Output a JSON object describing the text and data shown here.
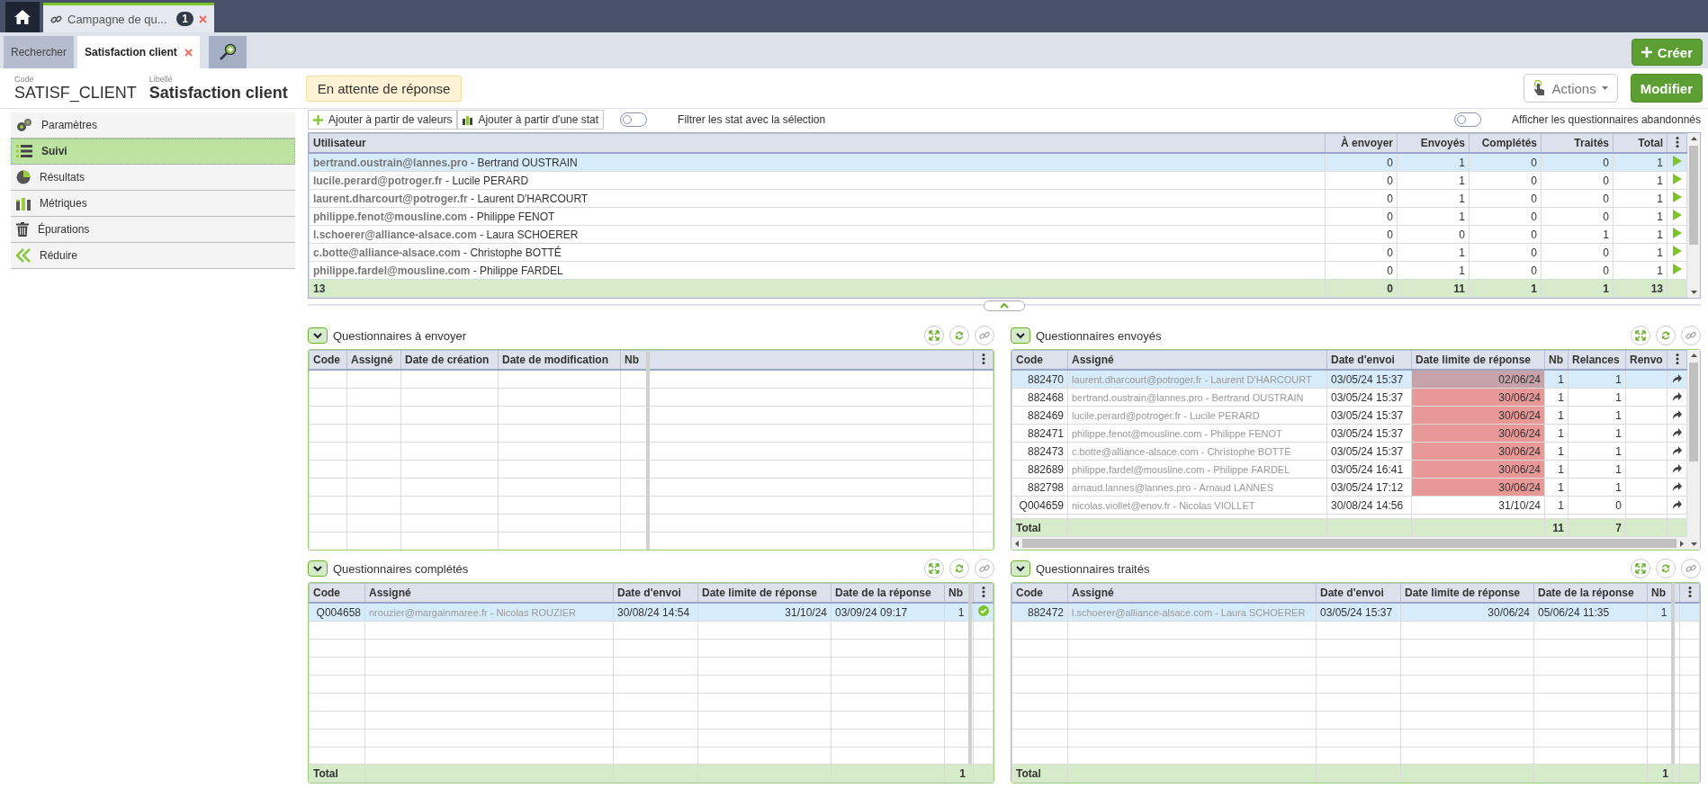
{
  "top_tabs": [
    {
      "label": "Campagne de qu...",
      "badge": "1",
      "selected": true
    }
  ],
  "page_tabs": [
    {
      "label": "Rechercher",
      "selected": false,
      "closable": false
    },
    {
      "label": "Satisfaction client",
      "selected": true,
      "closable": true
    }
  ],
  "create_button": "Créer",
  "header": {
    "code_label": "Code",
    "code": "SATISF_CLIENT",
    "name_label": "Libellé",
    "name": "Satisfaction client",
    "status": "En attente de réponse",
    "actions": "Actions",
    "edit": "Modifier"
  },
  "sidebar": [
    {
      "label": "Paramètres",
      "selected": false
    },
    {
      "label": "Suivi",
      "selected": true
    },
    {
      "label": "Résultats",
      "selected": false
    },
    {
      "label": "Métriques",
      "selected": false
    },
    {
      "label": "Épurations",
      "selected": false
    },
    {
      "label": "Réduire",
      "selected": false
    }
  ],
  "toolbar": {
    "add_values": "Ajouter à partir de valeurs",
    "add_stat": "Ajouter à partir d'une stat",
    "filter": {
      "label": "Filtrer les stat avec la sélection",
      "on": false
    },
    "abandoned": {
      "label": "Afficher les questionnaires abandonnés",
      "on": false
    }
  },
  "users_table": {
    "columns": [
      "Utilisateur",
      "À envoyer",
      "Envoyés",
      "Complétés",
      "Traités",
      "Total"
    ],
    "rows": [
      {
        "user": "**bertrand.oustrain@lannes.pro** - Bertrand OUSTRAIN",
        "values": [
          "0",
          "1",
          "0",
          "0",
          "1"
        ],
        "selected": true
      },
      {
        "user": "**lucile.perard@potroger.fr** - Lucile PERARD",
        "values": [
          "0",
          "1",
          "0",
          "0",
          "1"
        ],
        "selected": false
      },
      {
        "user": "**laurent.dharcourt@potroger.fr** - Laurent D'HARCOURT",
        "values": [
          "0",
          "1",
          "0",
          "0",
          "1"
        ],
        "selected": false
      },
      {
        "user": "**philippe.fenot@mousline.com** - Philippe FENOT",
        "values": [
          "0",
          "1",
          "0",
          "0",
          "1"
        ],
        "selected": false
      },
      {
        "user": "**l.schoerer@alliance-alsace.com** - Laura SCHOERER",
        "values": [
          "0",
          "0",
          "0",
          "1",
          "1"
        ],
        "selected": false
      },
      {
        "user": "**c.botte@alliance-alsace.com** - Christophe BOTTÉ",
        "values": [
          "0",
          "1",
          "0",
          "0",
          "1"
        ],
        "selected": false
      },
      {
        "user": "**philippe.fardel@mousline.com** - Philippe FARDEL",
        "values": [
          "0",
          "1",
          "0",
          "0",
          "1"
        ],
        "selected": false
      }
    ],
    "total": [
      "13",
      "0",
      "11",
      "1",
      "1",
      "13"
    ]
  },
  "panels": [
    {
      "title": "Questionnaires à envoyer",
      "columns": [
        "Code",
        "Assigné",
        "Date de création",
        "Date de modification",
        "Nb"
      ]
    },
    {
      "title": "Questionnaires envoyés",
      "columns": [
        "Code",
        "Assigné",
        "Date d'envoi",
        "Date limite de réponse",
        "Nb",
        "Relances",
        "Renvo"
      ],
      "rows": [
        {
          "cells": [
            "882470",
            "laurent.dharcourt@potroger.fr - Laurent D'HARCOURT",
            "03/05/24 15:37",
            "02/06/24",
            "1",
            "1"
          ],
          "selected": true,
          "overdue": true
        },
        {
          "cells": [
            "882468",
            "bertrand.oustrain@lannes.pro - Bertrand OUSTRAIN",
            "03/05/24 15:37",
            "30/06/24",
            "1",
            "1"
          ],
          "selected": false,
          "overdue": true
        },
        {
          "cells": [
            "882469",
            "lucile.perard@potroger.fr - Lucile PERARD",
            "03/05/24 15:37",
            "30/06/24",
            "1",
            "1"
          ],
          "selected": false,
          "overdue": true
        },
        {
          "cells": [
            "882471",
            "philippe.fenot@mousline.com - Philippe FENOT",
            "03/05/24 15:37",
            "30/06/24",
            "1",
            "1"
          ],
          "selected": false,
          "overdue": true
        },
        {
          "cells": [
            "882473",
            "c.botte@alliance-alsace.com - Christophe BOTTÉ",
            "03/05/24 15:37",
            "30/06/24",
            "1",
            "1"
          ],
          "selected": false,
          "overdue": true
        },
        {
          "cells": [
            "882689",
            "philippe.fardel@mousline.com - Philippe FARDEL",
            "03/05/24 16:41",
            "30/06/24",
            "1",
            "1"
          ],
          "selected": false,
          "overdue": true
        },
        {
          "cells": [
            "882798",
            "arnaud.lannes@lannes.pro - Arnaud LANNES",
            "03/05/24 17:12",
            "30/06/24",
            "1",
            "1"
          ],
          "selected": false,
          "overdue": true
        },
        {
          "cells": [
            "Q004659",
            "nicolas.viollet@enov.fr - Nicolas VIOLLET",
            "30/08/24 14:56",
            "31/10/24",
            "1",
            "0"
          ],
          "selected": false,
          "overdue": false
        }
      ],
      "total": {
        "label": "Total",
        "nb": "11",
        "relances": "7"
      }
    },
    {
      "title": "Questionnaires complétés",
      "columns": [
        "Code",
        "Assigné",
        "Date d'envoi",
        "Date limite de réponse",
        "Date de la réponse",
        "Nb"
      ],
      "rows": [
        {
          "cells": [
            "Q004658",
            "nrouzier@margainmaree.fr - Nicolas ROUZIER",
            "30/08/24 14:54",
            "31/10/24",
            "03/09/24 09:17",
            "1"
          ],
          "selected": true
        }
      ],
      "total": {
        "label": "Total",
        "nb": "1"
      }
    },
    {
      "title": "Questionnaires traités",
      "columns": [
        "Code",
        "Assigné",
        "Date d'envoi",
        "Date limite de réponse",
        "Date de la réponse",
        "Nb"
      ],
      "rows": [
        {
          "cells": [
            "882472",
            "l.schoerer@alliance-alsace.com - Laura SCHOERER",
            "03/05/24 15:37",
            "30/06/24",
            "05/06/24 11:35",
            "1"
          ],
          "selected": true
        }
      ],
      "total": {
        "label": "Total",
        "nb": "1"
      }
    }
  ]
}
